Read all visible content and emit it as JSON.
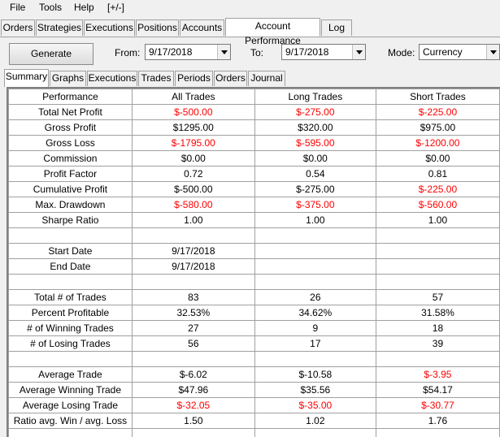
{
  "menu": {
    "file": "File",
    "tools": "Tools",
    "help": "Help",
    "toggle": "[+/-]"
  },
  "main_tabs": [
    "Orders",
    "Strategies",
    "Executions",
    "Positions",
    "Accounts",
    "Account Performance",
    "Log"
  ],
  "active_main_tab": "Account Performance",
  "toolbar": {
    "generate_label": "Generate",
    "from_label": "From:",
    "from_value": "9/17/2018",
    "to_label": "To:",
    "to_value": "9/17/2018",
    "mode_label": "Mode:",
    "mode_value": "Currency"
  },
  "sub_tabs": [
    "Summary",
    "Graphs",
    "Executions",
    "Trades",
    "Periods",
    "Orders",
    "Journal"
  ],
  "active_sub_tab": "Summary",
  "table": {
    "headers": [
      "Performance",
      "All Trades",
      "Long Trades",
      "Short Trades"
    ],
    "rows": [
      [
        "Total Net Profit",
        "$-500.00",
        "$-275.00",
        "$-225.00"
      ],
      [
        "Gross Profit",
        "$1295.00",
        "$320.00",
        "$975.00"
      ],
      [
        "Gross Loss",
        "$-1795.00",
        "$-595.00",
        "$-1200.00"
      ],
      [
        "Commission",
        "$0.00",
        "$0.00",
        "$0.00"
      ],
      [
        "Profit Factor",
        "0.72",
        "0.54",
        "0.81"
      ],
      [
        "Cumulative Profit",
        "$-500.00",
        "$-275.00",
        "$-225.00"
      ],
      [
        "Max. Drawdown",
        "$-580.00",
        "$-375.00",
        "$-560.00"
      ],
      [
        "Sharpe Ratio",
        "1.00",
        "1.00",
        "1.00"
      ],
      [
        "",
        "",
        "",
        ""
      ],
      [
        "Start Date",
        "9/17/2018",
        "",
        ""
      ],
      [
        "End Date",
        "9/17/2018",
        "",
        ""
      ],
      [
        "",
        "",
        "",
        ""
      ],
      [
        "Total # of Trades",
        "83",
        "26",
        "57"
      ],
      [
        "Percent Profitable",
        "32.53%",
        "34.62%",
        "31.58%"
      ],
      [
        "# of Winning Trades",
        "27",
        "9",
        "18"
      ],
      [
        "# of Losing Trades",
        "56",
        "17",
        "39"
      ],
      [
        "",
        "",
        "",
        ""
      ],
      [
        "Average Trade",
        "$-6.02",
        "$-10.58",
        "$-3.95"
      ],
      [
        "Average Winning Trade",
        "$47.96",
        "$35.56",
        "$54.17"
      ],
      [
        "Average Losing Trade",
        "$-32.05",
        "$-35.00",
        "$-30.77"
      ],
      [
        "Ratio avg. Win / avg. Loss",
        "1.50",
        "1.02",
        "1.76"
      ],
      [
        "",
        "",
        "",
        ""
      ]
    ],
    "red_cells": [
      [
        0,
        1
      ],
      [
        0,
        2
      ],
      [
        0,
        3
      ],
      [
        2,
        1
      ],
      [
        2,
        2
      ],
      [
        2,
        3
      ],
      [
        5,
        3
      ],
      [
        6,
        1
      ],
      [
        6,
        2
      ],
      [
        6,
        3
      ],
      [
        17,
        3
      ],
      [
        19,
        1
      ],
      [
        19,
        2
      ],
      [
        19,
        3
      ]
    ]
  }
}
